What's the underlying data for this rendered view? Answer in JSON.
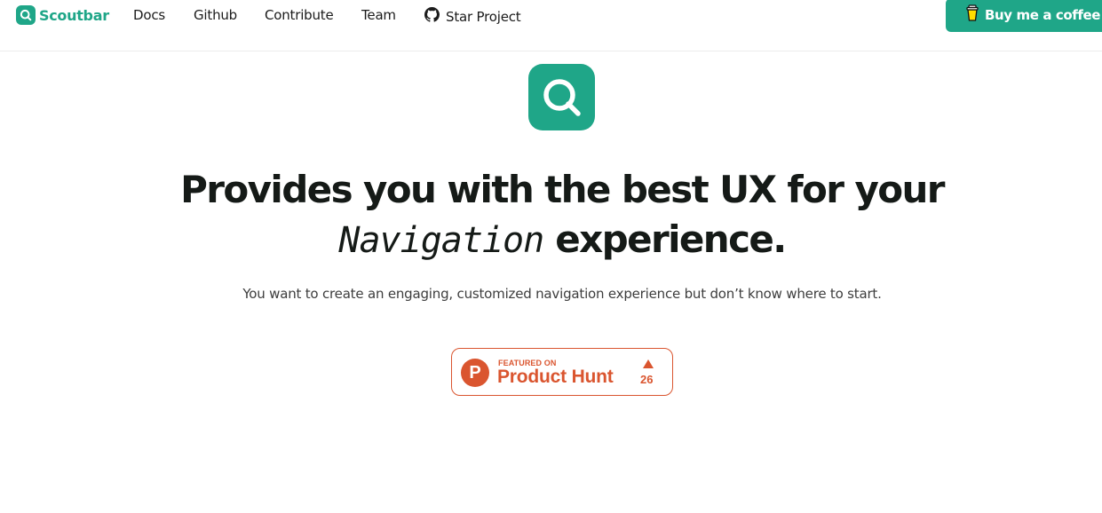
{
  "nav": {
    "brand": "Scoutbar",
    "links": {
      "docs": "Docs",
      "github": "Github",
      "contribute": "Contribute",
      "team": "Team",
      "star": "Star Project"
    },
    "coffee_button": "Buy me a coffee"
  },
  "hero": {
    "headline_line1": "Provides you with the best UX for your",
    "headline_mono": "Navigation",
    "headline_end": "experience.",
    "subtitle": "You want to create an engaging, customized navigation experience but don’t know where to start."
  },
  "product_hunt": {
    "letter": "P",
    "featured": "FEATURED ON",
    "name": "Product Hunt",
    "votes": "26"
  },
  "colors": {
    "brand": "#1fa688",
    "product_hunt": "#da552f",
    "text": "#151a17"
  },
  "icons": {
    "brand_logo": "search-icon",
    "star": "github-icon",
    "coffee": "coffee-cup-icon",
    "upvote": "triangle-up-icon"
  }
}
